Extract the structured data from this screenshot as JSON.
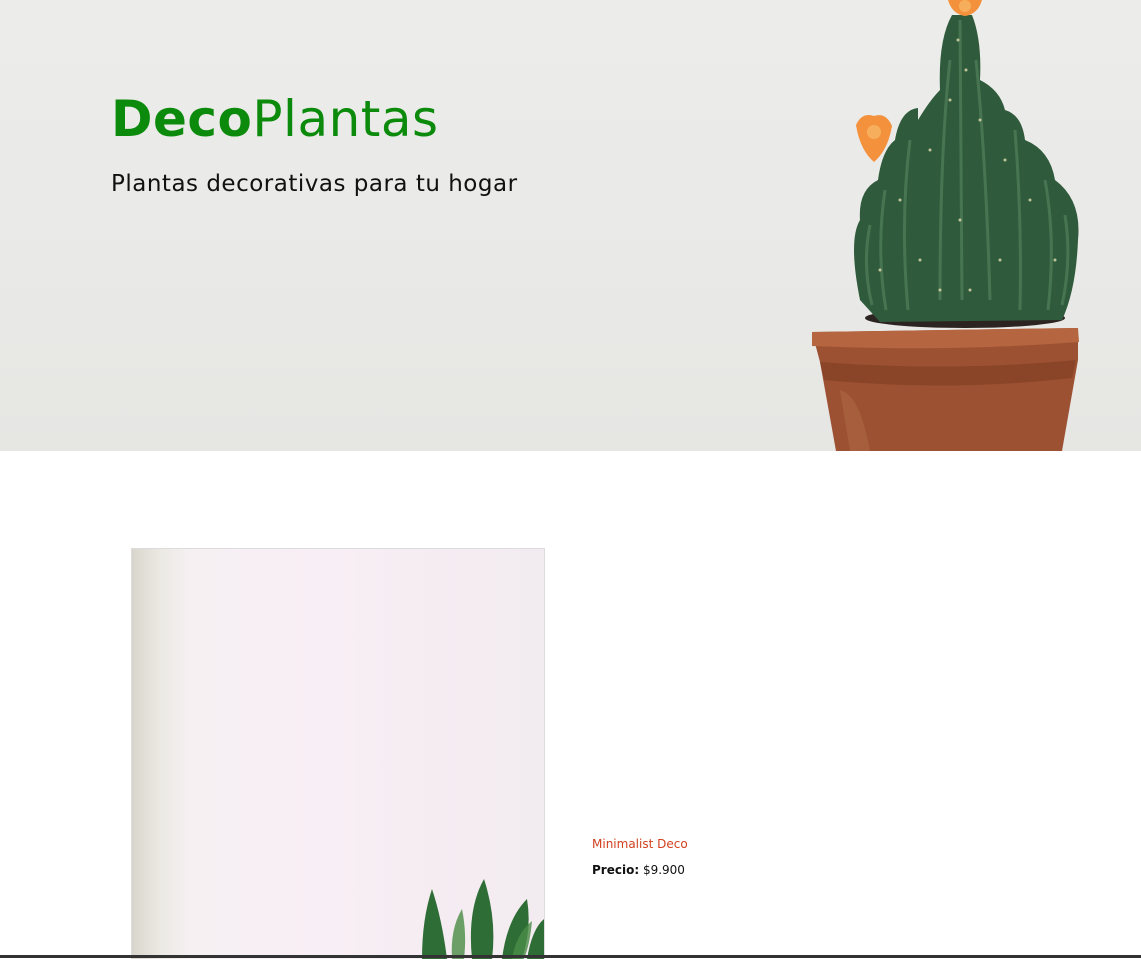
{
  "hero": {
    "brand_bold": "Deco",
    "brand_rest": "Plantas",
    "tagline": "Plantas decorativas para tu hogar",
    "image": "cactus-in-terracotta-pot"
  },
  "product": {
    "image": "snake-plant-photo",
    "name": "Minimalist Deco",
    "price_label": "Precio:",
    "price_value": "$9.900"
  },
  "colors": {
    "brand_green": "#0b8a0b",
    "product_name_red": "#d2401f",
    "hero_bg": "#eaeae8"
  }
}
